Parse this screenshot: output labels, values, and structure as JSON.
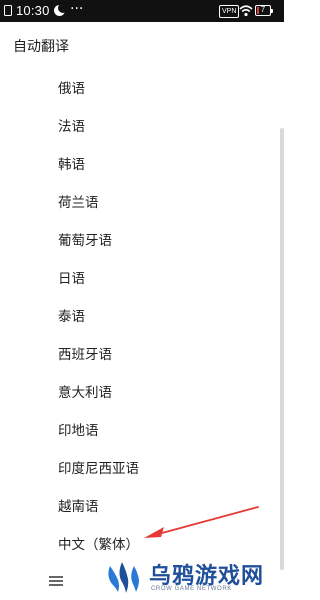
{
  "status_bar": {
    "time": "10:30",
    "more": "···",
    "vpn": "VPN",
    "battery_level": "7",
    "battery_color": "#e53935"
  },
  "header": {
    "title": "自动翻译"
  },
  "languages": [
    "俄语",
    "法语",
    "韩语",
    "荷兰语",
    "葡萄牙语",
    "日语",
    "泰语",
    "西班牙语",
    "意大利语",
    "印地语",
    "印度尼西亚语",
    "越南语",
    "中文（繁体）"
  ],
  "annotation": {
    "color": "#e53935",
    "points_to": "中文（繁体）"
  },
  "bottom_nav": {
    "menu_icon": "menu-icon"
  },
  "watermark": {
    "title": "乌鸦游戏网",
    "subtitle": "CROW GAME NETWORK",
    "color": "#1f4f9a"
  }
}
